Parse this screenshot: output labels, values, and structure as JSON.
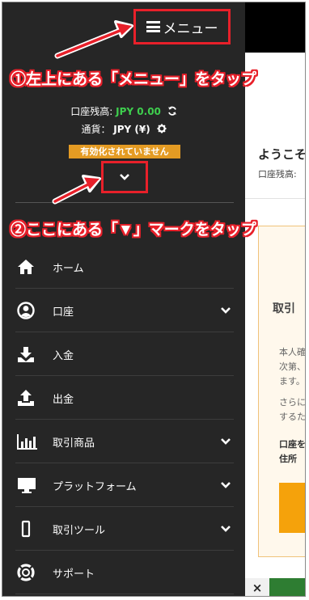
{
  "menu_button": {
    "label": "メニュー"
  },
  "account": {
    "balance_label": "口座残高:",
    "balance_value": "JPY 0.00",
    "currency_label": "通貨：",
    "currency_value": "JPY (¥)",
    "status_badge": "有効化されていません"
  },
  "nav": {
    "items": [
      {
        "label": "ホーム",
        "icon": "home-icon",
        "has_submenu": false
      },
      {
        "label": "口座",
        "icon": "user-circle-icon",
        "has_submenu": true
      },
      {
        "label": "入金",
        "icon": "download-icon",
        "has_submenu": false
      },
      {
        "label": "出金",
        "icon": "upload-icon",
        "has_submenu": false
      },
      {
        "label": "取引商品",
        "icon": "bar-chart-icon",
        "has_submenu": true
      },
      {
        "label": "プラットフォーム",
        "icon": "monitor-icon",
        "has_submenu": true
      },
      {
        "label": "取引ツール",
        "icon": "tool-icon",
        "has_submenu": true
      },
      {
        "label": "サポート",
        "icon": "life-ring-icon",
        "has_submenu": false
      }
    ]
  },
  "page": {
    "welcome": "ようこそ",
    "balance_partial": "口座残高:",
    "card_title": "取引",
    "paragraph1": "本人確\n次第、\nます。",
    "paragraph2": "さらに\nするた",
    "paragraph3": "口座を\n住所",
    "close": "×"
  },
  "annotations": {
    "step1": "①左上にある「メニュー」をタップ",
    "step2": "②ここにある「▼」マークをタップ"
  },
  "colors": {
    "menu_bg": "#262626",
    "highlight_red": "#e8202a",
    "badge_orange": "#e49b23",
    "balance_green": "#3ecf4e"
  }
}
